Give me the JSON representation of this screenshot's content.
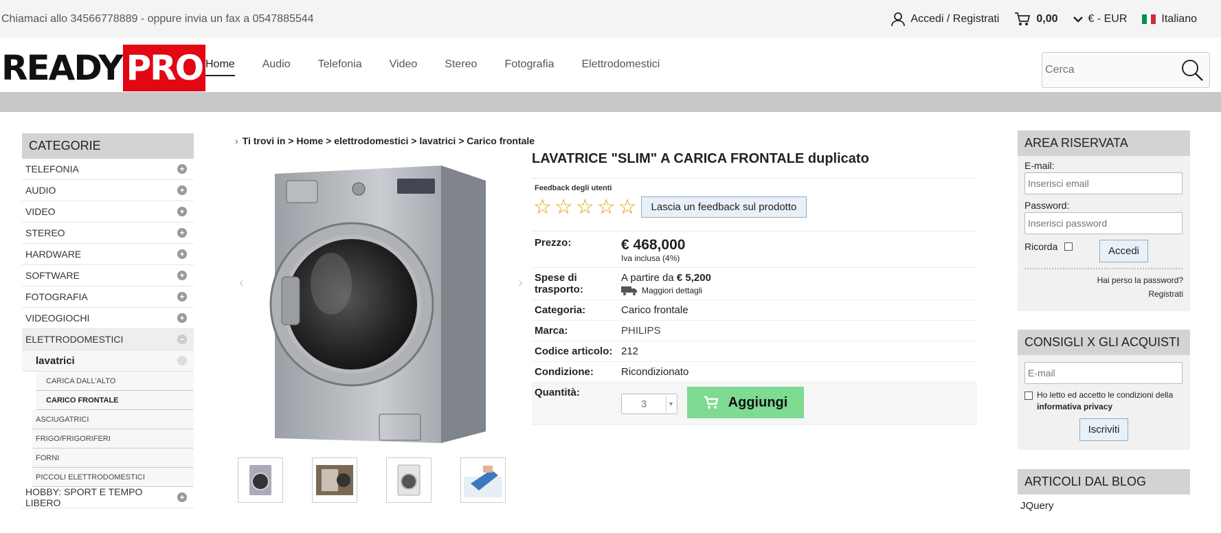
{
  "topbar": {
    "contact_text": "Chiamaci allo 34566778889 - oppure invia un fax a 0547885544",
    "login_label": "Accedi / Registrati",
    "cart_value": "0,00",
    "currency": "€ - EUR",
    "language": "Italiano"
  },
  "logo": {
    "ready": "READY",
    "pro": "PRO"
  },
  "nav": [
    "Home",
    "Audio",
    "Telefonia",
    "Video",
    "Stereo",
    "Fotografia",
    "Elettrodomestici"
  ],
  "search": {
    "placeholder": "Cerca"
  },
  "sidebar": {
    "title": "CATEGORIE",
    "categories": [
      "TELEFONIA",
      "AUDIO",
      "VIDEO",
      "STEREO",
      "HARDWARE",
      "SOFTWARE",
      "FOTOGRAFIA",
      "VIDEOGIOCHI",
      "ELETTRODOMESTICI"
    ],
    "open_sub": "lavatrici",
    "open_sub_children": [
      "CARICA DALL'ALTO",
      "CARICO FRONTALE"
    ],
    "siblings": [
      "ASCIUGATRICI",
      "FRIGO/FRIGORIFERI",
      "FORNI",
      "PICCOLI ELETTRODOMESTICI"
    ],
    "last_category": "HOBBY: SPORT E TEMPO LIBERO"
  },
  "breadcrumb": {
    "prefix": "Ti trovi in",
    "items": [
      "Home",
      "elettrodomestici",
      "lavatrici",
      "Carico frontale"
    ]
  },
  "product": {
    "title": "LAVATRICE \"SLIM\" A CARICA FRONTALE duplicato",
    "feedback_label": "Feedback degli utenti",
    "feedback_button": "Lascia un feedback sul prodotto",
    "rating": 0,
    "price_label": "Prezzo:",
    "price": "€ 468,000",
    "vat": "Iva inclusa (4%)",
    "shipping_label": "Spese di trasporto:",
    "shipping_prefix": "A partire da",
    "shipping_value": "€ 5,200",
    "shipping_details": "Maggiori dettagli",
    "category_label": "Categoria:",
    "category_value": "Carico frontale",
    "brand_label": "Marca:",
    "brand_value": "PHILIPS",
    "code_label": "Codice articolo:",
    "code_value": "212",
    "condition_label": "Condizione:",
    "condition_value": "Ricondizionato",
    "qty_label": "Quantità:",
    "qty_value": "3",
    "add_button": "Aggiungi"
  },
  "reserved": {
    "title": "AREA RISERVATA",
    "email_label": "E-mail:",
    "email_placeholder": "Inserisci email",
    "password_label": "Password:",
    "password_placeholder": "Inserisci password",
    "remember_label": "Ricorda",
    "login_button": "Accedi",
    "forgot": "Hai perso la password?",
    "register": "Registrati"
  },
  "advice": {
    "title": "CONSIGLI X GLI ACQUISTI",
    "email_placeholder": "E-mail",
    "consent_prefix": "Ho letto ed accetto le condizioni della",
    "consent_link": "informativa privacy",
    "button": "Iscriviti"
  },
  "blog": {
    "title": "ARTICOLI DAL BLOG",
    "first_post": "JQuery"
  },
  "colors": {
    "brand_red": "#e30613",
    "add_green": "#7ddb92",
    "star": "#e0a100"
  }
}
